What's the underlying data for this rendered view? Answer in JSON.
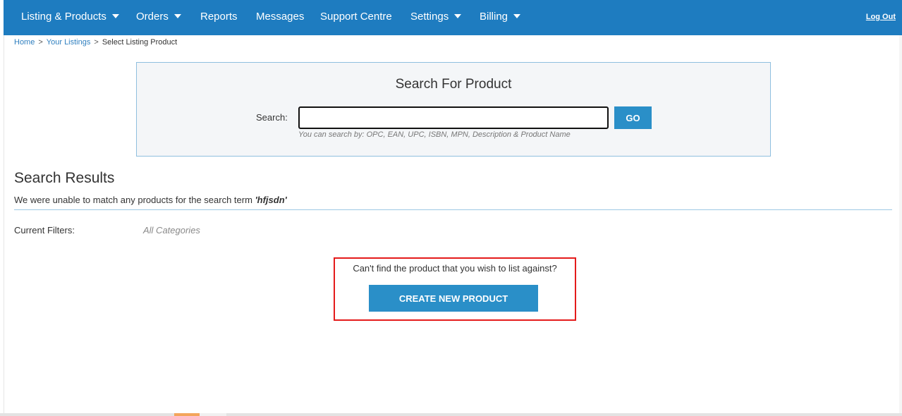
{
  "nav": {
    "items": [
      {
        "label": "Listing & Products",
        "has_dropdown": true
      },
      {
        "label": "Orders",
        "has_dropdown": true
      },
      {
        "label": "Reports",
        "has_dropdown": false
      },
      {
        "label": "Messages",
        "has_dropdown": false
      },
      {
        "label": "Support Centre",
        "has_dropdown": false
      },
      {
        "label": "Settings",
        "has_dropdown": true
      },
      {
        "label": "Billing",
        "has_dropdown": true
      }
    ],
    "logout": "Log Out",
    "background": "#1e7cc0"
  },
  "breadcrumb": {
    "home": "Home",
    "sep": ">",
    "listings": "Your Listings",
    "current": "Select Listing Product"
  },
  "search": {
    "title": "Search For Product",
    "label": "Search:",
    "value": "",
    "go_label": "GO",
    "hint": "You can search by: OPC, EAN, UPC, ISBN, MPN, Description & Product Name"
  },
  "results": {
    "title": "Search Results",
    "message_prefix": "We were unable to match any products for the search term",
    "term": "'hfjsdn'",
    "filters_label": "Current Filters:",
    "filters_value": "All Categories"
  },
  "create": {
    "prompt": "Can't find the product that you wish to list against?",
    "button_label": "CREATE NEW PRODUCT"
  },
  "colors": {
    "accent": "#2a8fc8",
    "highlight": "#e41b1b"
  }
}
